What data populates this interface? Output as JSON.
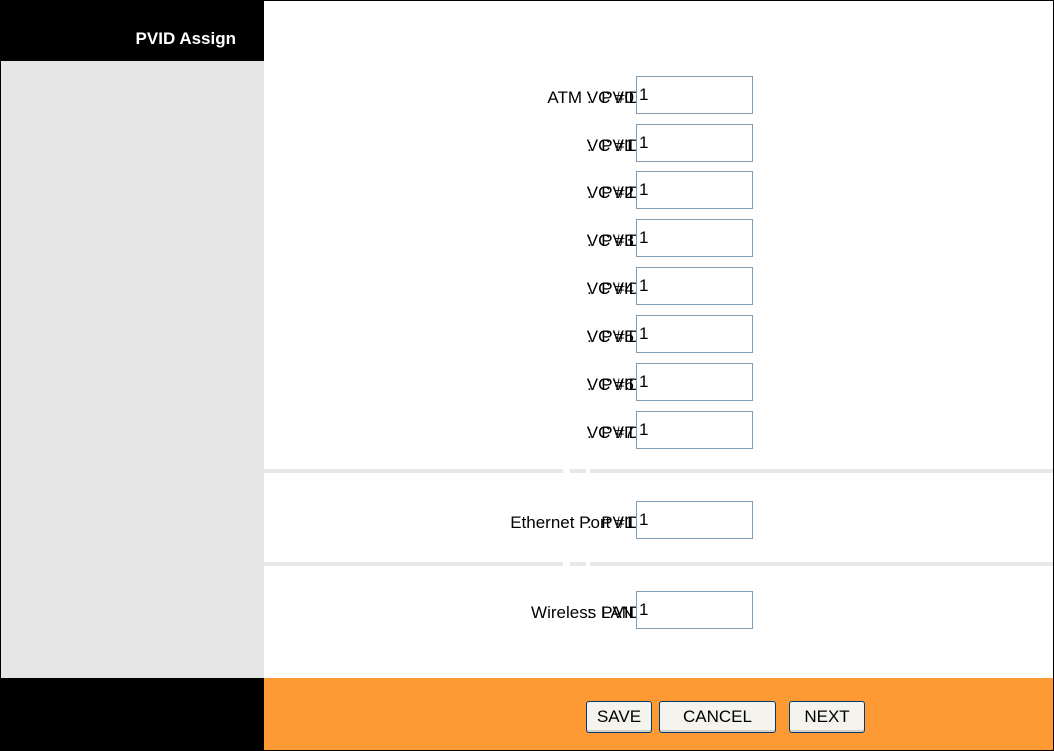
{
  "sidebar": {
    "title": "PVID Assign"
  },
  "pvid_label": "PVID",
  "colon": ":",
  "rows": [
    {
      "label": "ATM VC #0",
      "value": "1"
    },
    {
      "label": "VC #1",
      "value": "1"
    },
    {
      "label": "VC #2",
      "value": "1"
    },
    {
      "label": "VC #3",
      "value": "1"
    },
    {
      "label": "VC #4",
      "value": "1"
    },
    {
      "label": "VC #5",
      "value": "1"
    },
    {
      "label": "VC #6",
      "value": "1"
    },
    {
      "label": "VC #7",
      "value": "1"
    }
  ],
  "ethernet": {
    "label": "Ethernet Port #1",
    "value": "1"
  },
  "wireless": {
    "label": "Wireless LAN",
    "value": "1"
  },
  "buttons": {
    "save": "SAVE",
    "cancel": "CANCEL",
    "next": "NEXT"
  },
  "colors": {
    "header_bg": "#000000",
    "sidebar_bg": "#e6e6e6",
    "footer_accent": "#fd9a33"
  }
}
